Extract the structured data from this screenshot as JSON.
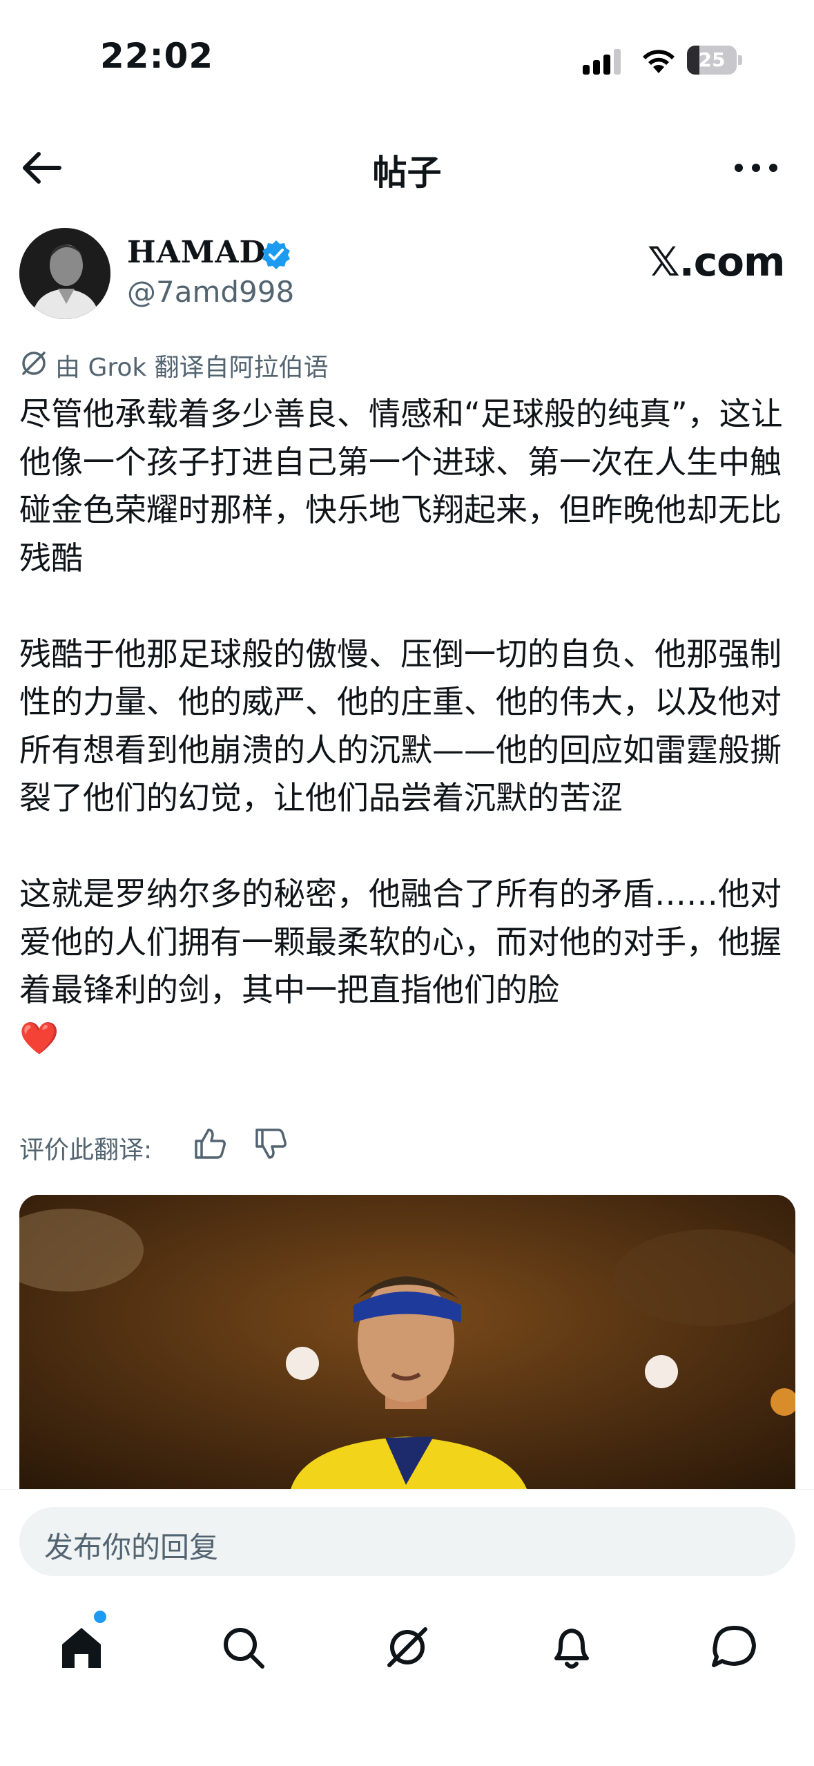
{
  "status_bar": {
    "time": "22:02",
    "battery": "25",
    "battery_level": 0.25
  },
  "header": {
    "title": "帖子"
  },
  "author": {
    "name": "HAMAD",
    "handle": "@7amd998",
    "site_mark": "𝕏.com"
  },
  "translation": {
    "label": "由 Grok 翻译自阿拉伯语",
    "rate_label": "评价此翻译:"
  },
  "post": {
    "body": "尽管他承载着多少善良、情感和“足球般的纯真”，这让他像一个孩子打进自己第一个进球、第一次在人生中触碰金色荣耀时那样，快乐地飞翔起来，但昨晚他却无比残酷\n\n残酷于他那足球般的傲慢、压倒一切的自负、他那强制性的力量、他的威严、他的庄重、他的伟大，以及他对所有想看到他崩溃的人的沉默——他的回应如雷霆般撕裂了他们的幻觉，让他们品尝着沉默的苦涩\n\n这就是罗纳尔多的秘密，他融合了所有的矛盾……他对爱他的人们拥有一颗最柔软的心，而对他的对手，他握着最锋利的剑，其中一把直指他们的脸\n❤️"
  },
  "reply": {
    "placeholder": "发布你的回复"
  },
  "tabs": [
    "home-icon",
    "search-icon",
    "grok-icon",
    "notifications-icon",
    "messages-icon"
  ],
  "colors": {
    "accent": "#1d9bf0",
    "secondary_text": "#536471",
    "heart": "#e0245e"
  }
}
